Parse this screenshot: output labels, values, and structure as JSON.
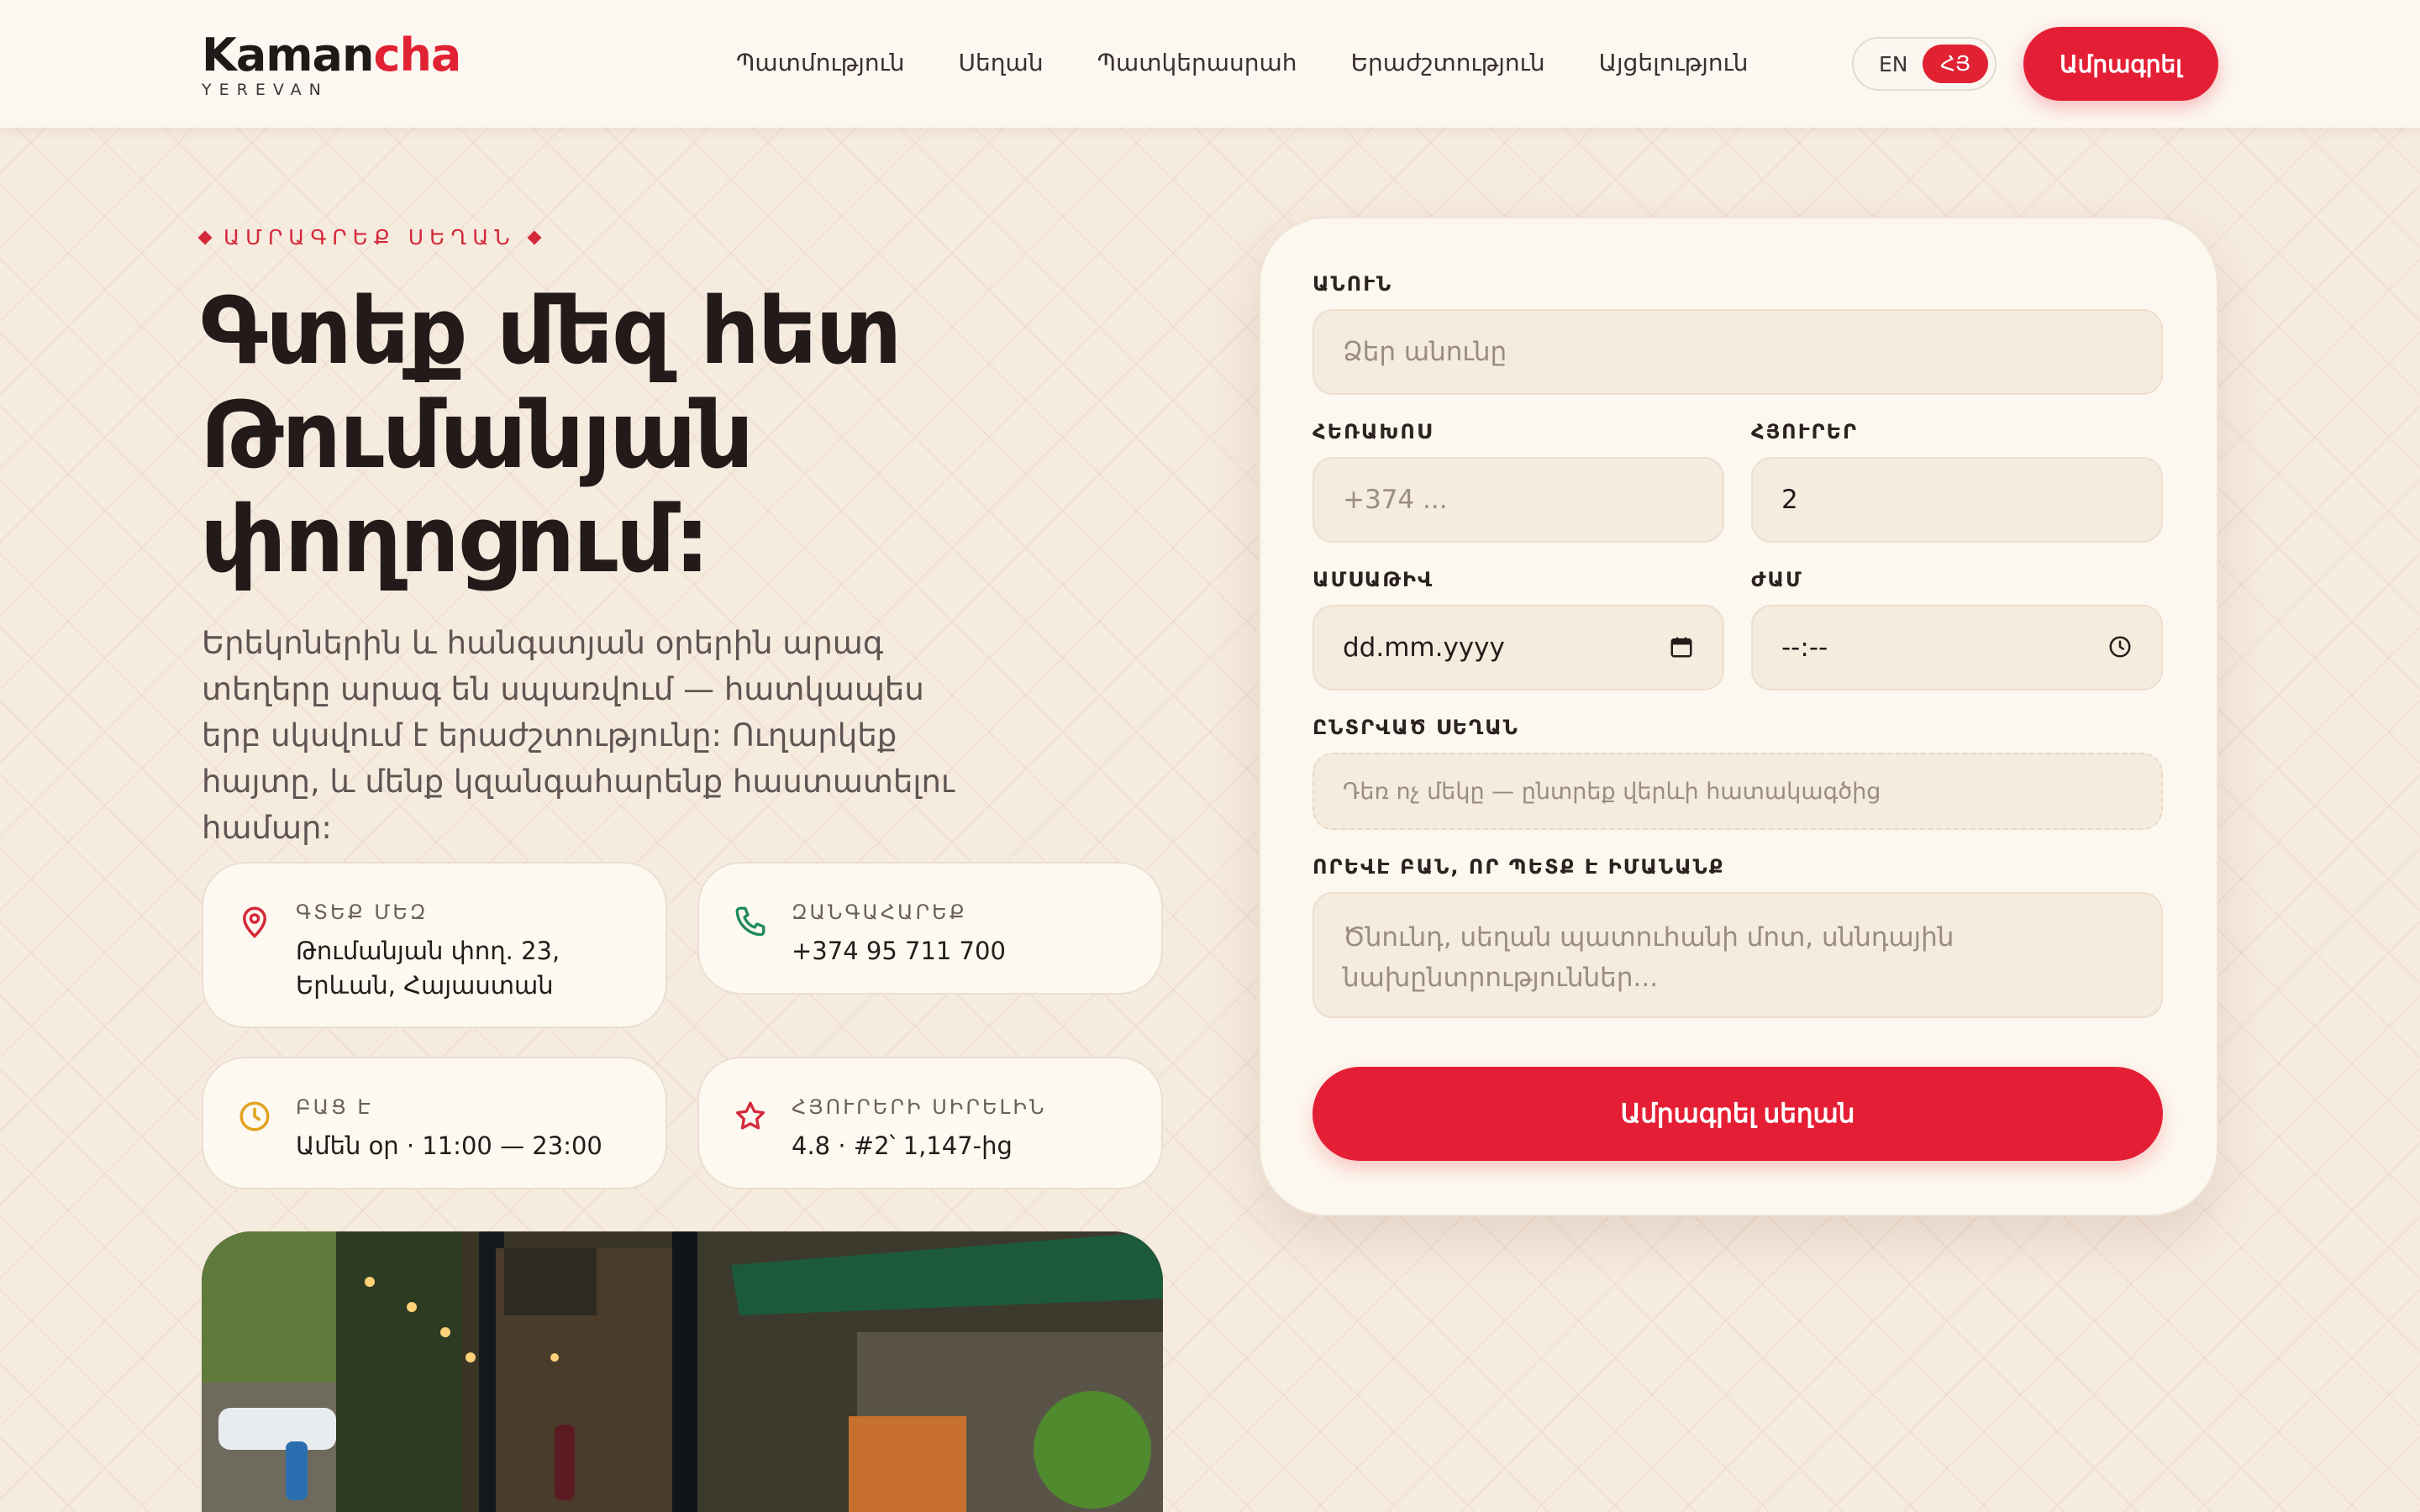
{
  "brand": {
    "name_dark": "Kaman",
    "name_red": "cha",
    "subtitle": "YEREVAN"
  },
  "nav": [
    {
      "label": "Պատմություն"
    },
    {
      "label": "Սեղան"
    },
    {
      "label": "Պատկերասրահ"
    },
    {
      "label": "Երաժշտություն"
    },
    {
      "label": "Այցելություն"
    }
  ],
  "lang": {
    "en": "EN",
    "hy": "ՀՅ",
    "active": "ՀՅ"
  },
  "header_cta": "Ամրագրել",
  "hero": {
    "eyebrow": "ԱՄՐԱԳՐԵՔ ՍԵՂԱՆ",
    "headline_lines": [
      "Գտեք մեզ հետ",
      "Թումանյան",
      "փողոցում:"
    ],
    "lead": "Երեկոներին և հանգստյան օրերին արագ տեղերը արագ են սպառվում — հատկապես երբ սկսվում է երաժշտությունը: Ուղարկեք հայտը, և մենք կզանգահարենք հաստատելու համար:"
  },
  "info_cards": [
    {
      "icon": "map-pin-icon",
      "label": "ԳՏԵՔ ՄԵԶ",
      "value": "Թումանյան փող. 23, Երևան, Հայաստան"
    },
    {
      "icon": "phone-icon",
      "label": "ԶԱՆԳԱՀԱՐԵՔ",
      "value": "+374 95 711 700"
    },
    {
      "icon": "clock-icon",
      "label": "ԲԱՑ Է",
      "value": "Ամեն օր · 11:00 — 23:00"
    },
    {
      "icon": "star-icon",
      "label": "ՀՅՈՒՐԵՐԻ ՍԻՐԵԼԻՆ",
      "value": "4.8 · #2՝ 1,147-ից"
    }
  ],
  "form": {
    "name": {
      "label": "ԱՆՈՒՆ",
      "placeholder": "Ձեր անունը",
      "value": ""
    },
    "phone": {
      "label": "ՀԵՌԱԽՈՍ",
      "placeholder": "+374 ...",
      "value": ""
    },
    "guests": {
      "label": "ՀՅՈՒՐԵՐ",
      "value": "2"
    },
    "date": {
      "label": "ԱՄՍԱԹԻՎ",
      "placeholder": "dd.mm.yyyy"
    },
    "time": {
      "label": "ԺԱՄ",
      "placeholder": "--:--"
    },
    "table": {
      "label": "ԸՆՏՐՎԱԾ ՍԵՂԱՆ",
      "placeholder": "Դեռ ոչ մեկը — ընտրեք վերևի հատակագծից"
    },
    "notes": {
      "label": "ՈՐԵՎԷ ԲԱՆ, ՈՐ ՊԵՏՔ Է ԻՄԱՆԱՆՔ",
      "placeholder": "Ծնունդ, սեղան պատուհանի մոտ, սննդային նախընտրություններ..."
    },
    "submit": "Ամրագրել սեղան"
  },
  "colors": {
    "accent": "#e41f35",
    "background": "#f6ebdf",
    "card": "#fdf8f0"
  }
}
